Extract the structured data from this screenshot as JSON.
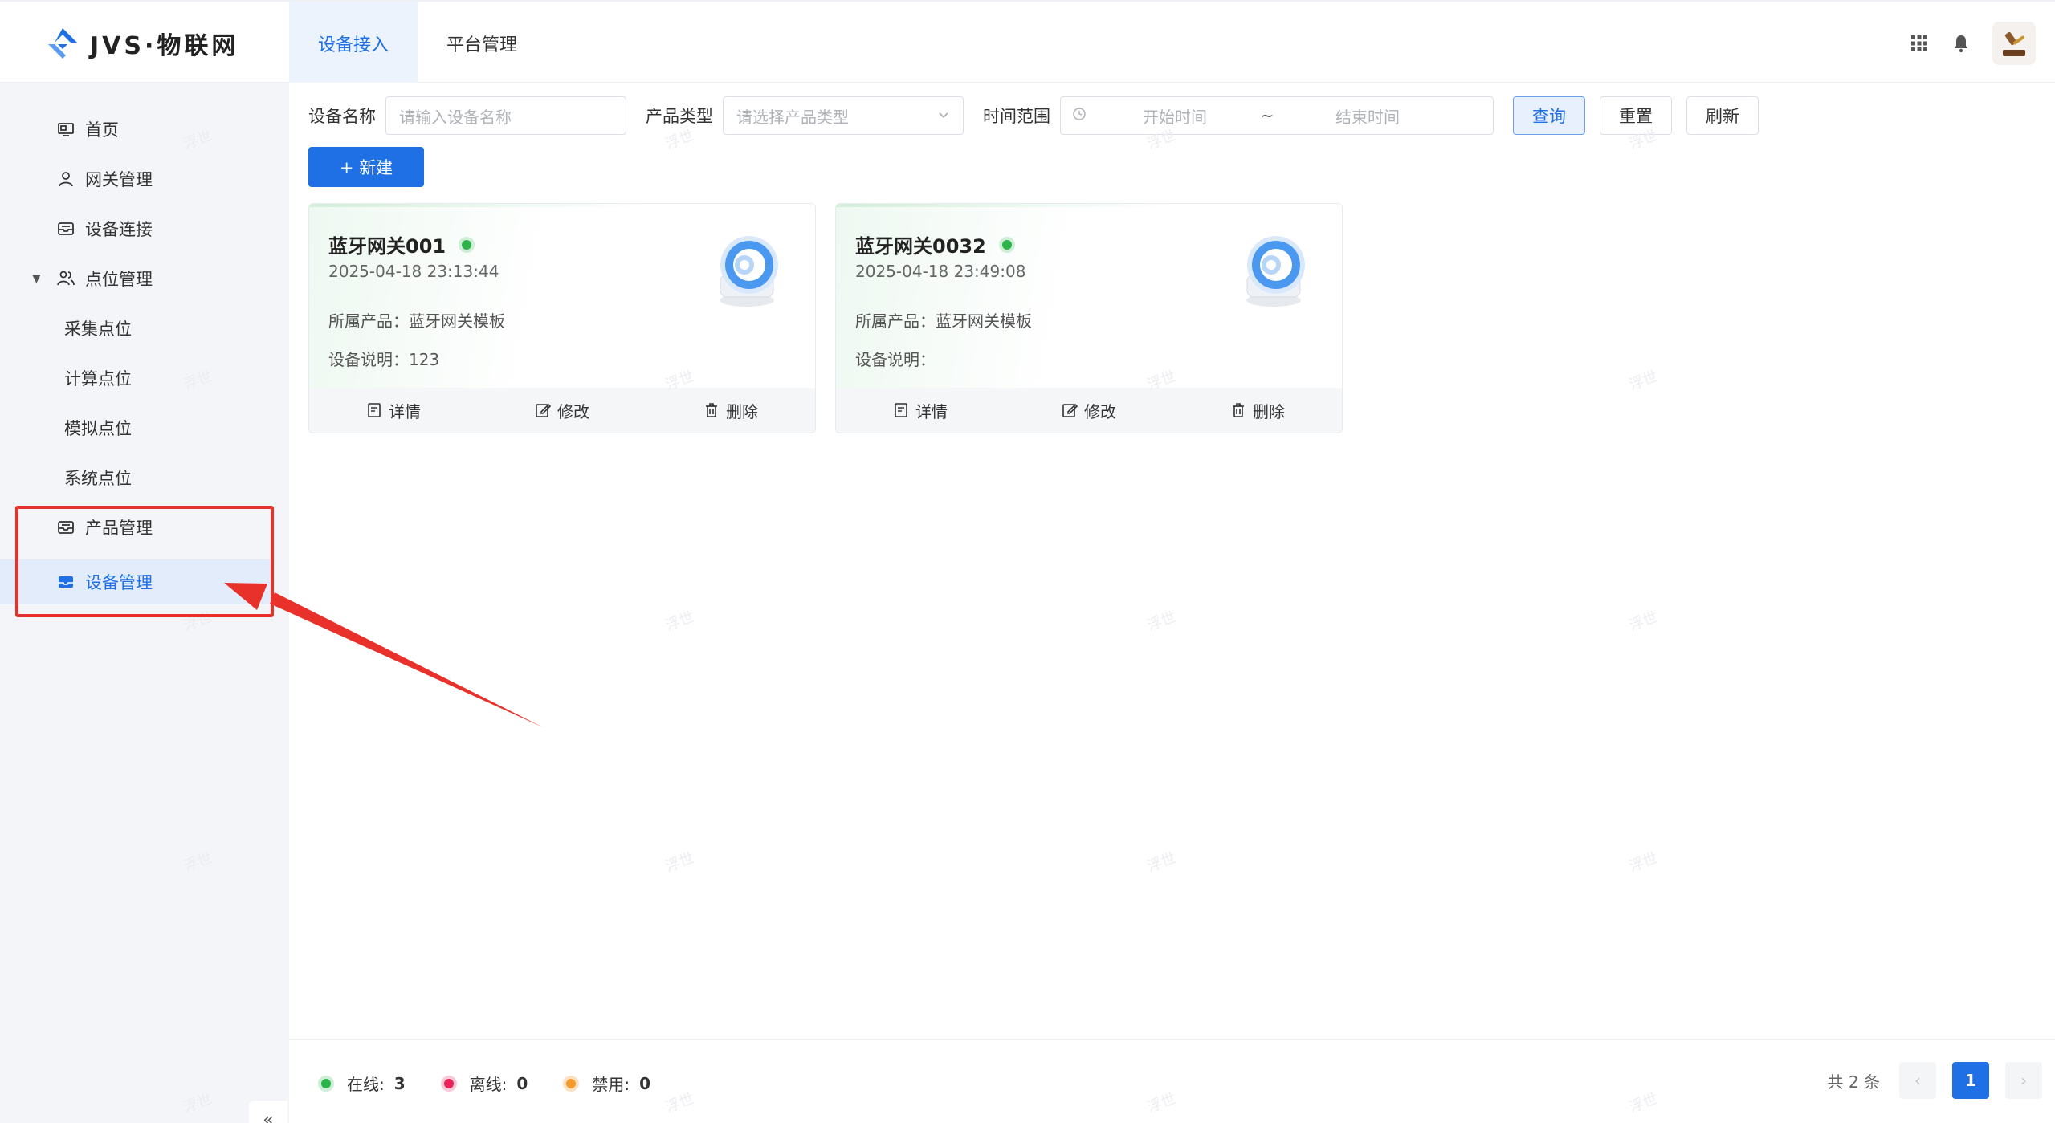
{
  "app": {
    "logo_text": "JVS·物联网"
  },
  "top_tabs": [
    {
      "label": "设备接入",
      "active": true
    },
    {
      "label": "平台管理",
      "active": false
    }
  ],
  "sidebar": {
    "items": [
      {
        "label": "首页",
        "icon": "monitor-icon"
      },
      {
        "label": "网关管理",
        "icon": "user-icon"
      },
      {
        "label": "设备连接",
        "icon": "inbox-icon"
      },
      {
        "label": "点位管理",
        "icon": "users-icon"
      },
      {
        "label": "采集点位"
      },
      {
        "label": "计算点位"
      },
      {
        "label": "模拟点位"
      },
      {
        "label": "系统点位"
      },
      {
        "label": "产品管理",
        "icon": "inbox-icon"
      },
      {
        "label": "设备管理",
        "icon": "inbox-icon",
        "active": true
      }
    ],
    "collapse_label": "«"
  },
  "filters": {
    "device_name_label": "设备名称",
    "device_name_placeholder": "请输入设备名称",
    "product_type_label": "产品类型",
    "product_type_placeholder": "请选择产品类型",
    "time_range_label": "时间范围",
    "start_placeholder": "开始时间",
    "range_sep": "~",
    "end_placeholder": "结束时间",
    "query_label": "查询",
    "reset_label": "重置",
    "refresh_label": "刷新"
  },
  "new_button": {
    "label": "+ 新建"
  },
  "cards": [
    {
      "title": "蓝牙网关001",
      "time": "2025-04-18 23:13:44",
      "product_line": "所属产品：蓝牙网关模板",
      "desc_line": "设备说明：123",
      "actions": [
        "详情",
        "修改",
        "删除"
      ]
    },
    {
      "title": "蓝牙网关0032",
      "time": "2025-04-18 23:49:08",
      "product_line": "所属产品：蓝牙网关模板",
      "desc_line": "设备说明：",
      "actions": [
        "详情",
        "修改",
        "删除"
      ]
    }
  ],
  "status_legend": [
    {
      "label": "在线:",
      "value": "3",
      "color": "#2cb34a"
    },
    {
      "label": "离线:",
      "value": "0",
      "color": "#e8245a"
    },
    {
      "label": "禁用:",
      "value": "0",
      "color": "#f59a2d"
    }
  ],
  "pagination": {
    "total_text": "共 2 条",
    "prev": "‹",
    "current": "1",
    "next": "›"
  },
  "watermark": "浮世",
  "colors": {
    "primary": "#1f6fe5",
    "sidebar_bg": "#f4f5f8",
    "annotation": "#e8312a"
  }
}
